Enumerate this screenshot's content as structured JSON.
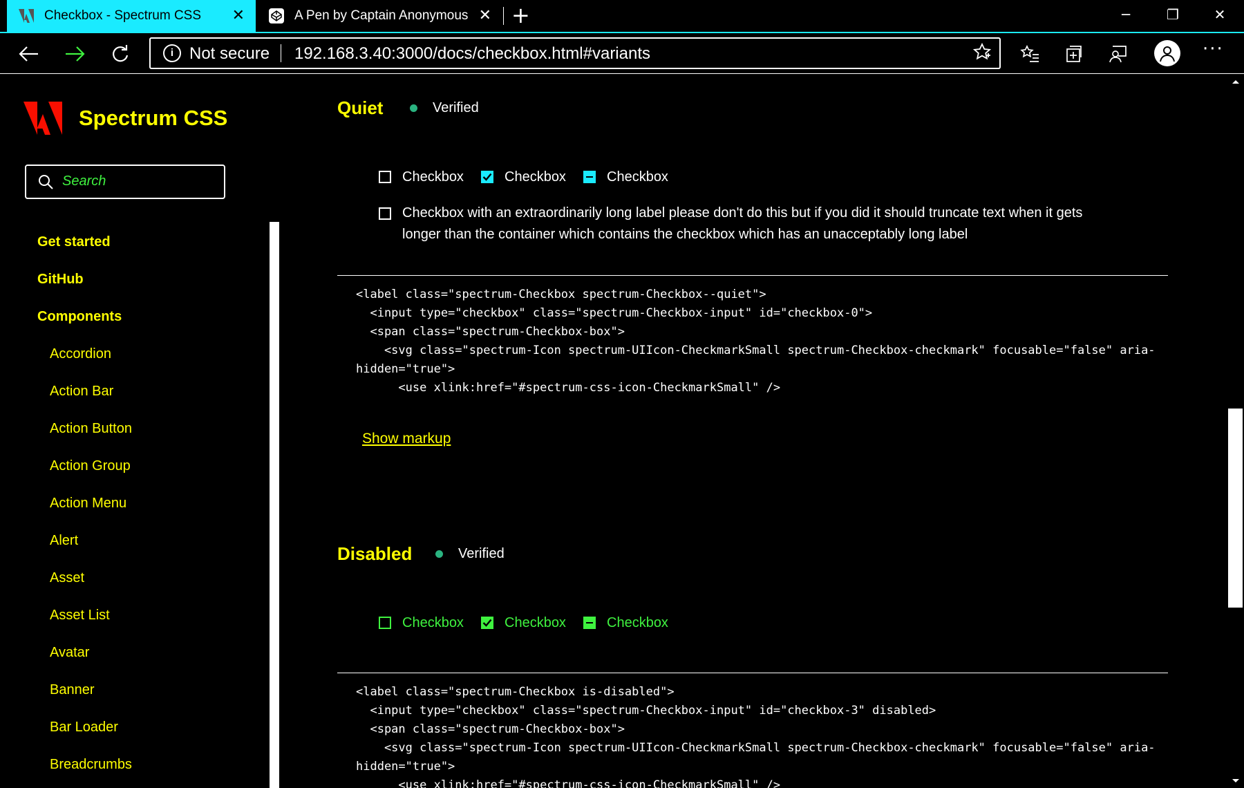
{
  "browser": {
    "tabs": [
      {
        "title": "Checkbox - Spectrum CSS",
        "active": true
      },
      {
        "title": "A Pen by Captain Anonymous",
        "active": false
      }
    ],
    "security_label": "Not secure",
    "url": "192.168.3.40:3000/docs/checkbox.html#variants",
    "accent_color": "#1aebff"
  },
  "sidebar": {
    "brand": "Spectrum CSS",
    "search_placeholder": "Search",
    "top_items": [
      "Get started",
      "GitHub",
      "Components"
    ],
    "components": [
      "Accordion",
      "Action Bar",
      "Action Button",
      "Action Group",
      "Action Menu",
      "Alert",
      "Asset",
      "Asset List",
      "Avatar",
      "Banner",
      "Bar Loader",
      "Breadcrumbs"
    ]
  },
  "sections": {
    "quiet": {
      "title": "Quiet",
      "status": "Verified",
      "checkboxes": [
        "Checkbox",
        "Checkbox",
        "Checkbox"
      ],
      "long_label": "Checkbox with an extraordinarily long label please don't do this but if you did it should truncate text when it gets longer than the container which contains the checkbox which has an unacceptably long label",
      "code": [
        "<label class=\"spectrum-Checkbox spectrum-Checkbox--quiet\">",
        "  <input type=\"checkbox\" class=\"spectrum-Checkbox-input\" id=\"checkbox-0\">",
        "  <span class=\"spectrum-Checkbox-box\">",
        "    <svg class=\"spectrum-Icon spectrum-UIIcon-CheckmarkSmall spectrum-Checkbox-checkmark\" focusable=\"false\" aria-",
        "hidden=\"true\">",
        "      <use xlink:href=\"#spectrum-css-icon-CheckmarkSmall\" />"
      ],
      "show_markup": "Show markup"
    },
    "disabled": {
      "title": "Disabled",
      "status": "Verified",
      "checkboxes": [
        "Checkbox",
        "Checkbox",
        "Checkbox"
      ],
      "code": [
        "<label class=\"spectrum-Checkbox is-disabled\">",
        "  <input type=\"checkbox\" class=\"spectrum-Checkbox-input\" id=\"checkbox-3\" disabled>",
        "  <span class=\"spectrum-Checkbox-box\">",
        "    <svg class=\"spectrum-Icon spectrum-UIIcon-CheckmarkSmall spectrum-Checkbox-checkmark\" focusable=\"false\" aria-",
        "hidden=\"true\">",
        "      <use xlink:href=\"#spectrum-css-icon-CheckmarkSmall\" />"
      ]
    }
  },
  "colors": {
    "heading": "#ffff00",
    "link": "#ffff00",
    "disabled": "#3ff23f",
    "checked": "#1aebff",
    "verified_dot": "#2ab380"
  }
}
